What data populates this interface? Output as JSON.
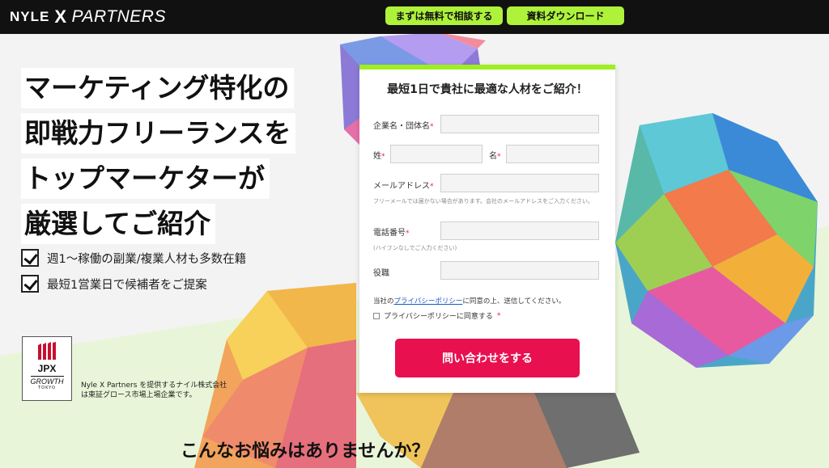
{
  "header": {
    "logo": {
      "nyle": "NYLE",
      "x": "X",
      "partners": "PARTNERS"
    },
    "consult_button": "まずは無料で相談する",
    "download_button": "資料ダウンロード"
  },
  "hero": {
    "lines": [
      "マーケティング特化の",
      "即戦力フリーランスを",
      "トップマーケターが",
      "厳選してご紹介"
    ]
  },
  "checks": [
    "週1〜稼働の副業/複業人材も多数在籍",
    "最短1営業日で候補者をご提案"
  ],
  "listing": {
    "badge_text": "JPX",
    "badge_growth": "GROWTH",
    "badge_tokyo": "TOKYO",
    "note_line1": "Nyle X Partners を提供するナイル株式会社",
    "note_line2": "は東証グロース市場上場企業です。"
  },
  "form": {
    "title": "最短1日で貴社に最適な人材をご紹介！",
    "company_label": "企業名・団体名",
    "last_name_label": "姓",
    "first_name_label": "名",
    "email_label": "メールアドレス",
    "email_note": "フリーメールでは届かない場合があります。会社のメールアドレスをご入力ください。",
    "phone_label": "電話番号",
    "phone_note": "(ハイフンなしでご入力ください)",
    "position_label": "役職",
    "required_mark": "*",
    "privacy_prefix": "当社の",
    "privacy_link": "プライバシーポリシー",
    "privacy_suffix": "に同意の上、送信してください。",
    "agree_label": "プライバシーポリシーに同意する",
    "submit": "問い合わせをする"
  },
  "section_question": "こんなお悩みはありませんか？",
  "colors": {
    "accent_green": "#aef23a",
    "submit_red": "#e8104f",
    "link_blue": "#1a57c9"
  }
}
